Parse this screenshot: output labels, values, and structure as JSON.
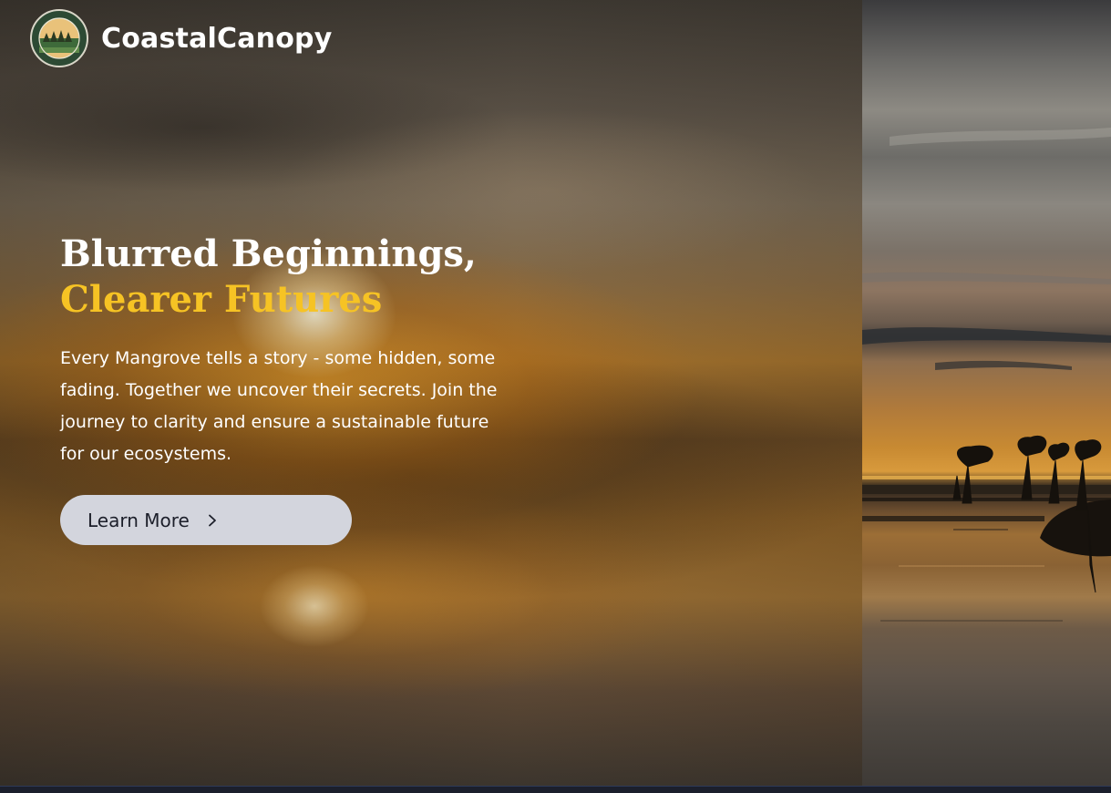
{
  "brand": {
    "name": "CoastalCanopy",
    "logo_text": "COASTALCANOPY"
  },
  "hero": {
    "headline_line1": "Blurred Beginnings,",
    "headline_line2": "Clearer Futures",
    "description": "Every Mangrove tells a story - some hidden, some fading. Together we uncover their secrets. Join the journey to clarity and ensure a sustainable future for our ecosystems.",
    "cta_label": "Learn More",
    "cta_icon": "chevron-right-icon"
  },
  "colors": {
    "accent": "#f6c324",
    "button_bg": "#d3d5dd",
    "text": "#ffffff"
  }
}
